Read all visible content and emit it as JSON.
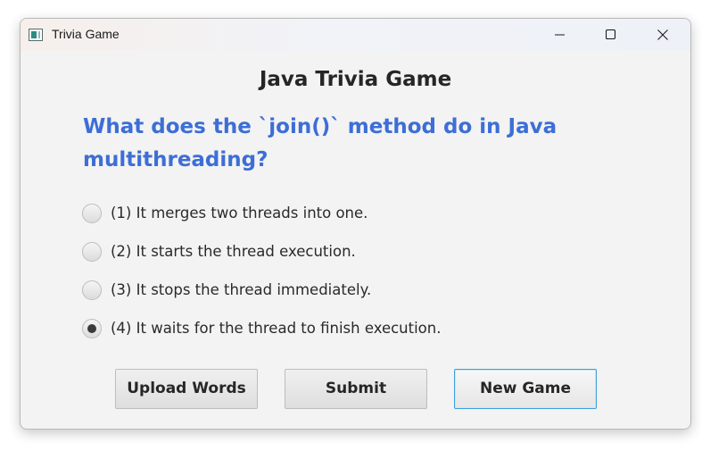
{
  "window": {
    "title": "Trivia Game"
  },
  "game": {
    "heading": "Java Trivia Game",
    "question": "What does the `join()` method do in Java multithreading?",
    "options": [
      {
        "label": "(1) It merges two threads into one.",
        "selected": false
      },
      {
        "label": "(2) It starts the thread execution.",
        "selected": false
      },
      {
        "label": "(3) It stops the thread immediately.",
        "selected": false
      },
      {
        "label": "(4) It waits for the thread to finish execution.",
        "selected": true
      }
    ]
  },
  "buttons": {
    "upload": "Upload Words",
    "submit": "Submit",
    "new_game": "New Game"
  },
  "colors": {
    "question": "#3d6ed6",
    "focus_border": "#3aa0dc"
  },
  "icons": {
    "app": "app-window-icon",
    "minimize": "minimize-icon",
    "maximize": "maximize-icon",
    "close": "close-icon"
  }
}
